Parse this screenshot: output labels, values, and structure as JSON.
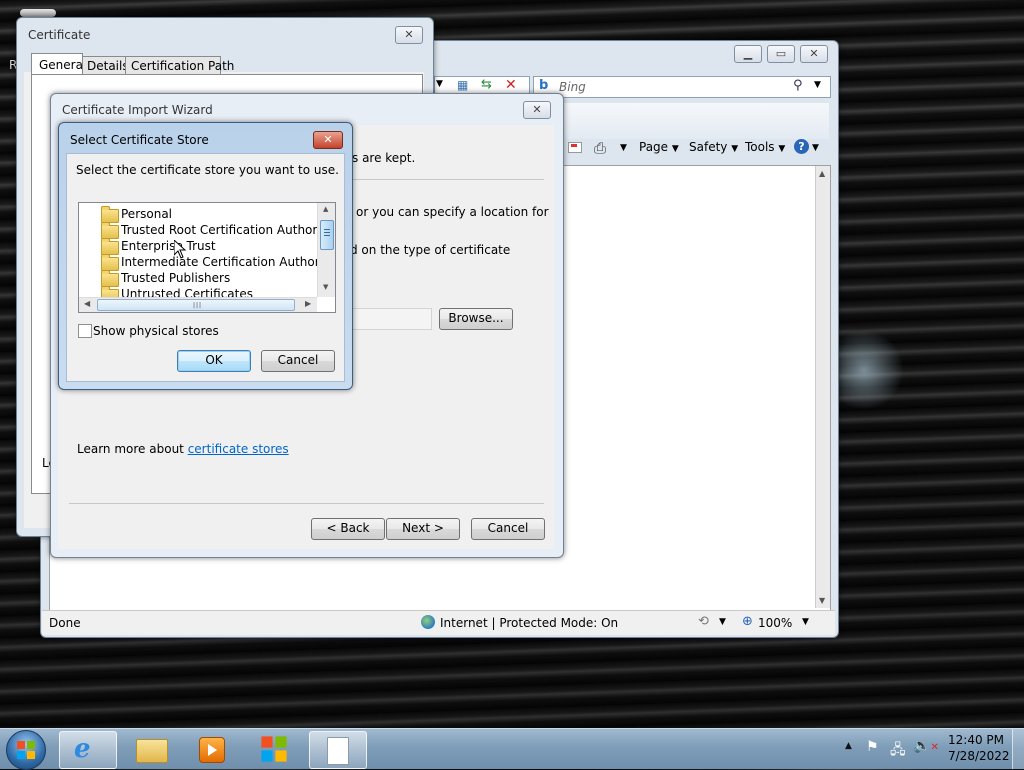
{
  "certificate": {
    "title": "Certificate",
    "close": "✕",
    "tabs": [
      "General",
      "Details",
      "Certification Path"
    ],
    "partial_label": "Le"
  },
  "ie": {
    "search_placeholder": "Bing",
    "toolbar": {
      "page": "Page",
      "safety": "Safety",
      "tools": "Tools"
    },
    "status": {
      "done": "Done",
      "zone": "Internet | Protected Mode: On",
      "zoom": "100%"
    },
    "side_letter": "R"
  },
  "wizard": {
    "title": "Certificate Import Wizard",
    "line_1": "s are kept.",
    "line_2": "or you can specify a location for",
    "line_3": "d on the type of certificate",
    "browse": "Browse...",
    "learn_more_prefix": "Learn more about ",
    "learn_more_link": "certificate stores",
    "back": "< Back",
    "next": "Next >",
    "cancel": "Cancel"
  },
  "store_dialog": {
    "title": "Select Certificate Store",
    "prompt": "Select the certificate store you want to use.",
    "stores": [
      "Personal",
      "Trusted Root Certification Authorities",
      "Enterprise Trust",
      "Intermediate Certification Authorities",
      "Trusted Publishers",
      "Untrusted Certificates"
    ],
    "show_physical": "Show physical stores",
    "ok": "OK",
    "cancel": "Cancel"
  },
  "tray": {
    "time": "12:40 PM",
    "date": "7/28/2022"
  }
}
